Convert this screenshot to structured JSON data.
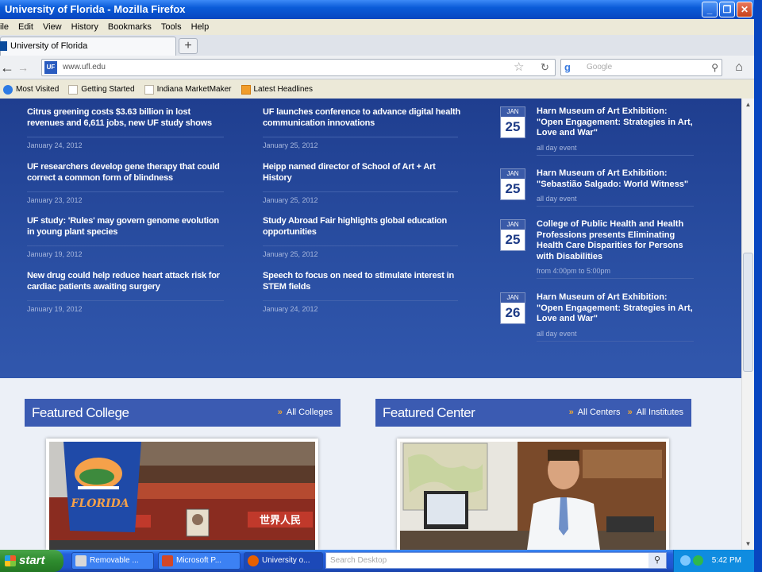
{
  "window": {
    "title": "University of Florida - Mozilla Firefox",
    "minimize": "_",
    "maximize": "❐",
    "close": "✕"
  },
  "menu": [
    "ile",
    "Edit",
    "View",
    "History",
    "Bookmarks",
    "Tools",
    "Help"
  ],
  "tab": {
    "label": "University of Florida",
    "new_tab": "+"
  },
  "nav": {
    "url": "www.ufl.edu",
    "search_placeholder": "Google",
    "back": "←",
    "forward": "→",
    "reload": "↻",
    "home": "⌂",
    "star": "☆",
    "favicon": "UF"
  },
  "bookmarks": [
    "Most Visited",
    "Getting Started",
    "Indiana MarketMaker",
    "Latest Headlines"
  ],
  "news_left": [
    {
      "title": "Citrus greening costs $3.63 billion in lost revenues and 6,611 jobs, new UF study shows",
      "date": "January 24, 2012"
    },
    {
      "title": "UF researchers develop gene therapy that could correct a common form of blindness",
      "date": "January 23, 2012"
    },
    {
      "title": "UF study: 'Rules' may govern genome evolution in young plant species",
      "date": "January 19, 2012"
    },
    {
      "title": "New drug could help reduce heart attack risk for cardiac patients awaiting surgery",
      "date": "January 19, 2012"
    }
  ],
  "news_mid": [
    {
      "title": "UF launches conference to advance digital health communication innovations",
      "date": "January 25, 2012"
    },
    {
      "title": "Heipp named director of School of Art + Art History",
      "date": "January 25, 2012"
    },
    {
      "title": "Study Abroad Fair highlights global education opportunities",
      "date": "January 25, 2012"
    },
    {
      "title": "Speech to focus on need to stimulate interest in STEM fields",
      "date": "January 24, 2012"
    }
  ],
  "events": [
    {
      "month": "JAN",
      "day": "25",
      "title": "Harn Museum of Art Exhibition: \"Open Engagement: Strategies in Art, Love and War\"",
      "time": "all day event"
    },
    {
      "month": "JAN",
      "day": "25",
      "title": "Harn Museum of Art Exhibition: \"Sebastião Salgado: World Witness\"",
      "time": "all day event"
    },
    {
      "month": "JAN",
      "day": "25",
      "title": "College of Public Health and Health Professions presents Eliminating Health Care Disparities for Persons with Disabilities",
      "time": "from 4:00pm to 5:00pm"
    },
    {
      "month": "JAN",
      "day": "26",
      "title": "Harn Museum of Art Exhibition: \"Open Engagement: Strategies in Art, Love and War\"",
      "time": "all day event"
    }
  ],
  "featured_college": {
    "title": "Featured College",
    "link": "All Colleges",
    "flag_text": "FLORIDA",
    "banner_text": "世界人民"
  },
  "featured_center": {
    "title": "Featured Center",
    "link1": "All Centers",
    "link2": "All Institutes"
  },
  "taskbar": {
    "start": "start",
    "tasks": [
      "Removable ...",
      "Microsoft P...",
      "University o..."
    ],
    "search_placeholder": "Search Desktop",
    "clock": "5:42 PM"
  },
  "colors": {
    "page_blue": "#2a4fa3",
    "accent_orange": "#f3a92e",
    "feature_header": "#3b5bb2"
  }
}
